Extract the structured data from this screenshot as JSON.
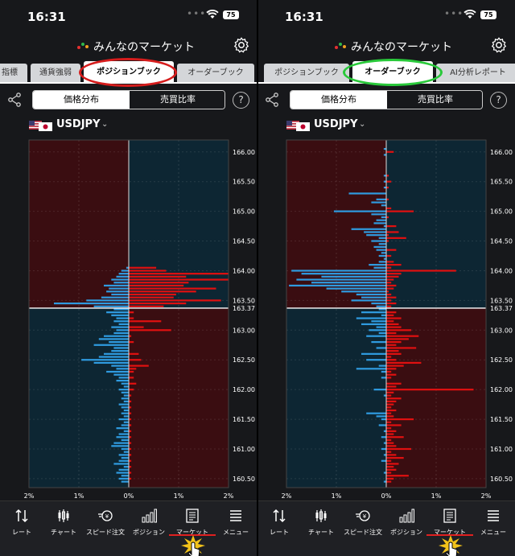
{
  "status": {
    "time": "16:31",
    "battery": "75"
  },
  "header": {
    "title": "みんなのマーケット"
  },
  "left": {
    "tabs": [
      "指標",
      "通貨強弱",
      "ポジションブック",
      "オーダーブック"
    ],
    "active_tab": "ポジションブック",
    "highlight_color": "#d61c1c"
  },
  "right": {
    "tabs": [
      "ポジションブック",
      "オーダーブック",
      "AI分析レポート"
    ],
    "active_tab": "オーダーブック",
    "highlight_color": "#29c93a"
  },
  "toolbar": {
    "segments": [
      "価格分布",
      "売買比率"
    ],
    "selected": "価格分布",
    "help": "?"
  },
  "pair": {
    "code": "USDJPY"
  },
  "nav": {
    "items": [
      "レート",
      "チャート",
      "スピード注文",
      "ポジション",
      "マーケット",
      "メニュー"
    ],
    "active": "マーケット"
  },
  "colors": {
    "buy": "#e01010",
    "sell": "#2f9be0",
    "bg_up_left": "#3a0d11",
    "bg_up_right": "#0d2633",
    "price_line": "#ffffff"
  },
  "chart_data": [
    {
      "type": "bar",
      "name": "ポジションブック",
      "orientation": "horizontal-diverging",
      "price_labels": [
        "166.00",
        "165.50",
        "165.00",
        "164.50",
        "164.00",
        "163.50",
        "163.37",
        "163.00",
        "162.50",
        "162.00",
        "161.50",
        "161.00",
        "160.50"
      ],
      "current_price": 163.37,
      "ylim": [
        160.35,
        166.2
      ],
      "x_ticks": [
        "2%",
        "1%",
        "0%",
        "1%",
        "2%"
      ],
      "xlim_percent": 2,
      "bin": 0.05,
      "left_label_side": "sell",
      "right_label_side": "buy",
      "sell": [
        [
          163.4,
          0.7
        ],
        [
          163.45,
          1.5
        ],
        [
          163.5,
          0.85
        ],
        [
          163.55,
          0.55
        ],
        [
          163.6,
          0.35
        ],
        [
          163.65,
          0.45
        ],
        [
          163.7,
          0.4
        ],
        [
          163.75,
          0.5
        ],
        [
          163.8,
          0.3
        ],
        [
          163.85,
          0.35
        ],
        [
          163.9,
          0.25
        ],
        [
          163.95,
          0.2
        ],
        [
          164.0,
          0.15
        ],
        [
          164.05,
          0.05
        ],
        [
          163.35,
          0.3
        ],
        [
          163.3,
          0.45
        ],
        [
          163.25,
          0.35
        ],
        [
          163.2,
          0.25
        ],
        [
          163.15,
          0.3
        ],
        [
          163.1,
          0.2
        ],
        [
          163.05,
          0.35
        ],
        [
          163.0,
          0.25
        ],
        [
          162.95,
          0.3
        ],
        [
          162.9,
          0.5
        ],
        [
          162.85,
          0.6
        ],
        [
          162.8,
          0.4
        ],
        [
          162.75,
          0.7
        ],
        [
          162.7,
          0.3
        ],
        [
          162.65,
          0.35
        ],
        [
          162.6,
          0.5
        ],
        [
          162.55,
          0.6
        ],
        [
          162.5,
          0.95
        ],
        [
          162.45,
          0.7
        ],
        [
          162.4,
          0.35
        ],
        [
          162.35,
          0.25
        ],
        [
          162.3,
          0.45
        ],
        [
          162.25,
          0.3
        ],
        [
          162.2,
          0.2
        ],
        [
          162.15,
          0.25
        ],
        [
          162.1,
          0.15
        ],
        [
          162.05,
          0.1
        ],
        [
          162.0,
          0.2
        ],
        [
          161.95,
          0.15
        ],
        [
          161.9,
          0.1
        ],
        [
          161.85,
          0.15
        ],
        [
          161.8,
          0.1
        ],
        [
          161.75,
          0.2
        ],
        [
          161.7,
          0.15
        ],
        [
          161.65,
          0.1
        ],
        [
          161.6,
          0.15
        ],
        [
          161.55,
          0.1
        ],
        [
          161.5,
          0.2
        ],
        [
          161.45,
          0.1
        ],
        [
          161.4,
          0.15
        ],
        [
          161.35,
          0.25
        ],
        [
          161.3,
          0.1
        ],
        [
          161.25,
          0.2
        ],
        [
          161.2,
          0.25
        ],
        [
          161.15,
          0.15
        ],
        [
          161.1,
          0.3
        ],
        [
          161.05,
          0.35
        ],
        [
          161.0,
          0.15
        ],
        [
          160.95,
          0.1
        ],
        [
          160.9,
          0.2
        ],
        [
          160.85,
          0.15
        ],
        [
          160.8,
          0.2
        ],
        [
          160.75,
          0.3
        ],
        [
          160.7,
          0.1
        ],
        [
          160.65,
          0.2
        ],
        [
          160.6,
          0.25
        ],
        [
          160.55,
          0.15
        ],
        [
          160.5,
          0.2
        ],
        [
          160.45,
          0.15
        ]
      ],
      "buy": [
        [
          164.0,
          0.75
        ],
        [
          164.05,
          0.55
        ],
        [
          163.95,
          2.0
        ],
        [
          163.9,
          1.15
        ],
        [
          163.85,
          2.0
        ],
        [
          163.8,
          1.2
        ],
        [
          163.75,
          1.1
        ],
        [
          163.7,
          1.75
        ],
        [
          163.65,
          1.35
        ],
        [
          163.6,
          0.95
        ],
        [
          163.55,
          0.9
        ],
        [
          163.5,
          1.85
        ],
        [
          163.45,
          1.15
        ],
        [
          163.4,
          0.7
        ],
        [
          163.3,
          0.1
        ],
        [
          163.2,
          0.1
        ],
        [
          163.15,
          0.65
        ],
        [
          163.05,
          0.3
        ],
        [
          163.0,
          0.85
        ],
        [
          162.9,
          0.05
        ],
        [
          162.8,
          0.1
        ],
        [
          162.6,
          0.2
        ],
        [
          162.5,
          0.25
        ],
        [
          162.4,
          0.4
        ],
        [
          162.35,
          0.15
        ],
        [
          162.3,
          0.1
        ],
        [
          162.2,
          0.1
        ],
        [
          162.1,
          0.15
        ],
        [
          162.0,
          0.1
        ],
        [
          161.9,
          0.05
        ],
        [
          161.8,
          0.05
        ],
        [
          161.7,
          0.05
        ],
        [
          161.6,
          0.05
        ],
        [
          161.5,
          0.05
        ],
        [
          161.4,
          0.05
        ],
        [
          161.3,
          0.05
        ],
        [
          161.2,
          0.05
        ],
        [
          161.1,
          0.05
        ],
        [
          161.0,
          0.05
        ],
        [
          160.9,
          0.05
        ],
        [
          160.8,
          0.05
        ],
        [
          160.7,
          0.05
        ],
        [
          160.6,
          0.05
        ],
        [
          160.5,
          0.05
        ]
      ]
    },
    {
      "type": "bar",
      "name": "オーダーブック",
      "orientation": "horizontal-diverging",
      "price_labels": [
        "166.00",
        "165.50",
        "165.00",
        "164.50",
        "164.00",
        "163.50",
        "163.37",
        "163.00",
        "162.50",
        "162.00",
        "161.50",
        "161.00",
        "160.50"
      ],
      "current_price": 163.37,
      "ylim": [
        160.35,
        166.2
      ],
      "x_ticks": [
        "2%",
        "1%",
        "0%",
        "1%",
        "2%"
      ],
      "xlim_percent": 2,
      "bin": 0.05,
      "sell": [
        [
          166.05,
          0.05
        ],
        [
          165.95,
          0.05
        ],
        [
          165.6,
          0.05
        ],
        [
          165.5,
          0.05
        ],
        [
          165.4,
          0.05
        ],
        [
          165.3,
          0.75
        ],
        [
          165.2,
          0.2
        ],
        [
          165.15,
          0.3
        ],
        [
          165.1,
          0.1
        ],
        [
          165.0,
          1.05
        ],
        [
          164.95,
          0.3
        ],
        [
          164.9,
          0.1
        ],
        [
          164.85,
          0.2
        ],
        [
          164.8,
          0.25
        ],
        [
          164.75,
          0.05
        ],
        [
          164.7,
          0.7
        ],
        [
          164.65,
          0.45
        ],
        [
          164.6,
          0.4
        ],
        [
          164.55,
          0.15
        ],
        [
          164.5,
          0.3
        ],
        [
          164.45,
          0.15
        ],
        [
          164.4,
          0.25
        ],
        [
          164.35,
          0.2
        ],
        [
          164.3,
          0.1
        ],
        [
          164.25,
          0.15
        ],
        [
          164.2,
          0.05
        ],
        [
          164.15,
          0.15
        ],
        [
          164.1,
          0.35
        ],
        [
          164.05,
          0.25
        ],
        [
          164.0,
          1.9
        ],
        [
          163.95,
          1.7
        ],
        [
          163.9,
          1.3
        ],
        [
          163.85,
          1.8
        ],
        [
          163.8,
          1.5
        ],
        [
          163.75,
          1.95
        ],
        [
          163.7,
          1.2
        ],
        [
          163.65,
          0.9
        ],
        [
          163.6,
          0.6
        ],
        [
          163.55,
          0.5
        ],
        [
          163.5,
          0.7
        ],
        [
          163.45,
          0.3
        ],
        [
          163.4,
          0.2
        ],
        [
          163.35,
          0.15
        ],
        [
          163.3,
          0.5
        ],
        [
          163.25,
          0.1
        ],
        [
          163.2,
          0.6
        ],
        [
          163.15,
          0.3
        ],
        [
          163.1,
          0.5
        ],
        [
          163.05,
          0.2
        ],
        [
          163.0,
          0.35
        ],
        [
          162.95,
          0.15
        ],
        [
          162.9,
          0.4
        ],
        [
          162.8,
          0.3
        ],
        [
          162.7,
          0.2
        ],
        [
          162.6,
          0.5
        ],
        [
          162.5,
          0.4
        ],
        [
          162.4,
          0.15
        ],
        [
          162.35,
          0.6
        ],
        [
          162.3,
          0.1
        ],
        [
          162.2,
          0.1
        ],
        [
          162.0,
          0.25
        ],
        [
          161.9,
          0.05
        ],
        [
          161.6,
          0.4
        ],
        [
          161.55,
          0.2
        ],
        [
          161.5,
          0.1
        ],
        [
          161.4,
          0.15
        ],
        [
          161.3,
          0.05
        ],
        [
          161.2,
          0.1
        ],
        [
          161.1,
          0.05
        ],
        [
          161.0,
          0.1
        ],
        [
          160.9,
          0.05
        ],
        [
          160.8,
          0.1
        ],
        [
          160.6,
          0.05
        ],
        [
          160.45,
          0.05
        ]
      ],
      "buy": [
        [
          166.0,
          0.15
        ],
        [
          165.6,
          0.05
        ],
        [
          165.5,
          0.1
        ],
        [
          165.4,
          0.05
        ],
        [
          165.2,
          0.05
        ],
        [
          165.05,
          0.1
        ],
        [
          165.0,
          0.55
        ],
        [
          164.9,
          0.05
        ],
        [
          164.75,
          0.2
        ],
        [
          164.65,
          0.25
        ],
        [
          164.6,
          0.05
        ],
        [
          164.55,
          0.4
        ],
        [
          164.5,
          0.05
        ],
        [
          164.35,
          0.2
        ],
        [
          164.25,
          0.1
        ],
        [
          164.15,
          0.15
        ],
        [
          164.1,
          0.3
        ],
        [
          164.05,
          0.1
        ],
        [
          164.0,
          1.4
        ],
        [
          163.95,
          0.3
        ],
        [
          163.9,
          0.25
        ],
        [
          163.85,
          0.15
        ],
        [
          163.8,
          0.1
        ],
        [
          163.75,
          0.2
        ],
        [
          163.7,
          0.15
        ],
        [
          163.65,
          0.05
        ],
        [
          163.6,
          0.1
        ],
        [
          163.55,
          0.2
        ],
        [
          163.5,
          0.1
        ],
        [
          163.45,
          0.2
        ],
        [
          163.4,
          0.1
        ],
        [
          163.3,
          0.2
        ],
        [
          163.25,
          0.15
        ],
        [
          163.2,
          0.3
        ],
        [
          163.15,
          0.15
        ],
        [
          163.1,
          0.25
        ],
        [
          163.05,
          0.3
        ],
        [
          163.0,
          0.5
        ],
        [
          162.95,
          0.2
        ],
        [
          162.9,
          0.65
        ],
        [
          162.85,
          0.45
        ],
        [
          162.8,
          0.3
        ],
        [
          162.75,
          0.2
        ],
        [
          162.7,
          0.6
        ],
        [
          162.65,
          0.25
        ],
        [
          162.6,
          0.3
        ],
        [
          162.55,
          0.1
        ],
        [
          162.5,
          0.2
        ],
        [
          162.45,
          0.7
        ],
        [
          162.4,
          0.35
        ],
        [
          162.35,
          0.2
        ],
        [
          162.3,
          0.1
        ],
        [
          162.25,
          0.2
        ],
        [
          162.2,
          0.1
        ],
        [
          162.1,
          0.3
        ],
        [
          162.05,
          0.2
        ],
        [
          162.0,
          1.75
        ],
        [
          161.95,
          0.15
        ],
        [
          161.9,
          0.1
        ],
        [
          161.85,
          0.3
        ],
        [
          161.8,
          0.2
        ],
        [
          161.75,
          0.15
        ],
        [
          161.7,
          0.1
        ],
        [
          161.65,
          0.2
        ],
        [
          161.6,
          0.1
        ],
        [
          161.55,
          0.15
        ],
        [
          161.5,
          0.55
        ],
        [
          161.45,
          0.1
        ],
        [
          161.4,
          0.3
        ],
        [
          161.35,
          0.1
        ],
        [
          161.3,
          0.2
        ],
        [
          161.25,
          0.15
        ],
        [
          161.2,
          0.35
        ],
        [
          161.15,
          0.1
        ],
        [
          161.1,
          0.15
        ],
        [
          161.05,
          0.2
        ],
        [
          161.0,
          0.5
        ],
        [
          160.95,
          0.1
        ],
        [
          160.9,
          0.2
        ],
        [
          160.85,
          0.35
        ],
        [
          160.8,
          0.1
        ],
        [
          160.75,
          0.25
        ],
        [
          160.7,
          0.15
        ],
        [
          160.65,
          0.2
        ],
        [
          160.6,
          0.1
        ],
        [
          160.55,
          0.45
        ],
        [
          160.5,
          0.15
        ],
        [
          160.45,
          0.1
        ]
      ]
    }
  ]
}
